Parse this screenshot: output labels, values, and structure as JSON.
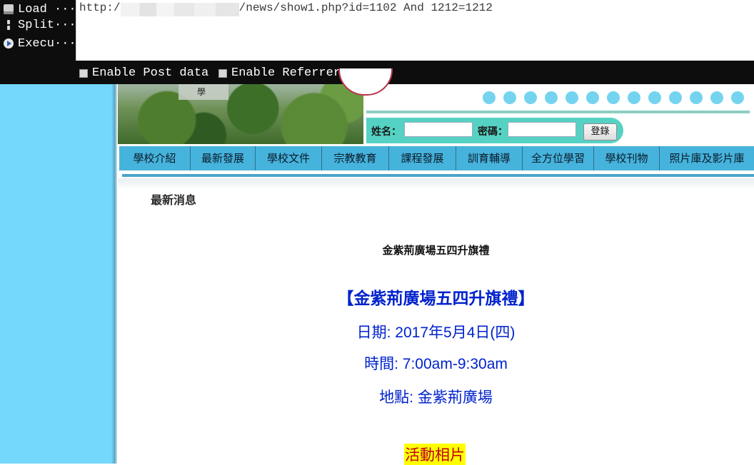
{
  "hackbar": {
    "load_label": "Load ···",
    "split_label": "Split···",
    "execute_label": "Execu···",
    "url_prefix": "http:/",
    "url_suffix": "/news/show1.php?id=1102 And 1212=1212",
    "post_data_label": "Enable Post data",
    "referrer_label": "Enable Referrer"
  },
  "header": {
    "banner_char": "學",
    "username_label": "姓名：",
    "password_label": "密碼：",
    "login_button": "登錄"
  },
  "nav": {
    "items": [
      {
        "label": "學校介紹"
      },
      {
        "label": "最新發展"
      },
      {
        "label": "學校文件"
      },
      {
        "label": "宗教教育"
      },
      {
        "label": "課程發展"
      },
      {
        "label": "訓育輔導"
      },
      {
        "label": "全方位學習"
      },
      {
        "label": "學校刊物"
      },
      {
        "label": "照片庫及影片庫"
      }
    ]
  },
  "content": {
    "section_heading": "最新消息",
    "article_title": "金紫荊廣場五四升旗禮",
    "headline": "【金紫荊廣場五四升旗禮】",
    "date_line": "日期: 2017年5月4日(四)",
    "time_line": "時間: 7:00am-9:30am",
    "place_line": "地點: 金紫荊廣場",
    "photos_link": "活動相片"
  },
  "colors": {
    "hackbar_bg": "#0d0d0d",
    "side_stripe": "#73d8fc",
    "nav_bg": "#46b3dc",
    "login_pill": "#55d2c4",
    "article_text": "#0022cc",
    "photos_link_text": "#c0001a",
    "photos_link_highlight": "#ffff00"
  }
}
